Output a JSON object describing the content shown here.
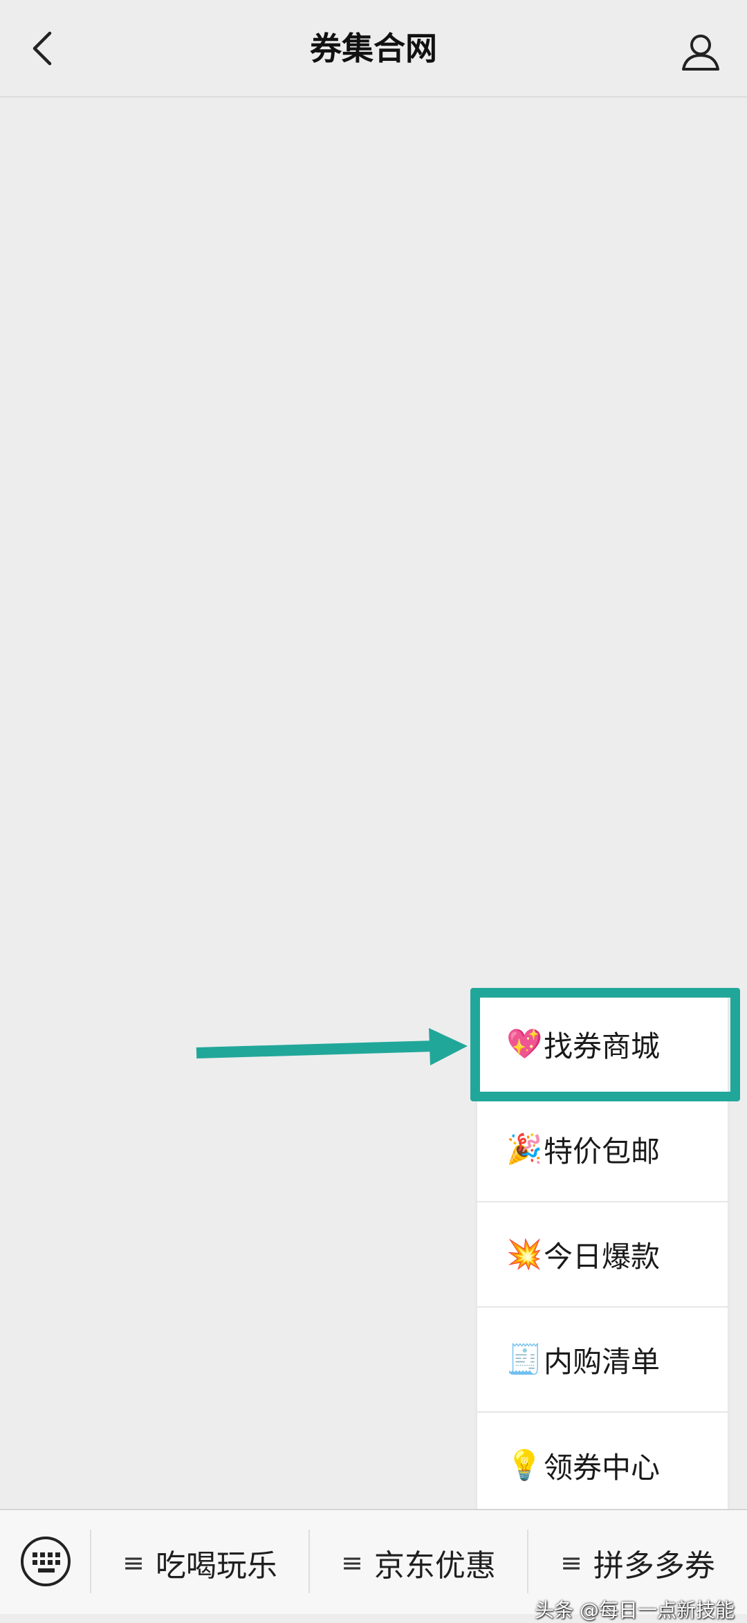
{
  "header": {
    "title": "券集合网",
    "back_icon": "chevron-left-icon",
    "profile_icon": "user-icon"
  },
  "menu": {
    "items": [
      {
        "emoji": "💖",
        "label": "找券商城"
      },
      {
        "emoji": "🎉",
        "label": "特价包邮"
      },
      {
        "emoji": "💥",
        "label": "今日爆款"
      },
      {
        "emoji": "🧾",
        "label": "内购清单"
      },
      {
        "emoji": "💡",
        "label": "领券中心"
      }
    ],
    "highlighted_index": 0
  },
  "annotation": {
    "highlight_color": "#21a79a"
  },
  "bottom_bar": {
    "keyboard_icon": "keyboard-icon",
    "tabs": [
      {
        "icon": "≡",
        "label": "吃喝玩乐"
      },
      {
        "icon": "≡",
        "label": "京东优惠"
      },
      {
        "icon": "≡",
        "label": "拼多多券"
      }
    ]
  },
  "watermark": "头条 @每日一点新技能"
}
